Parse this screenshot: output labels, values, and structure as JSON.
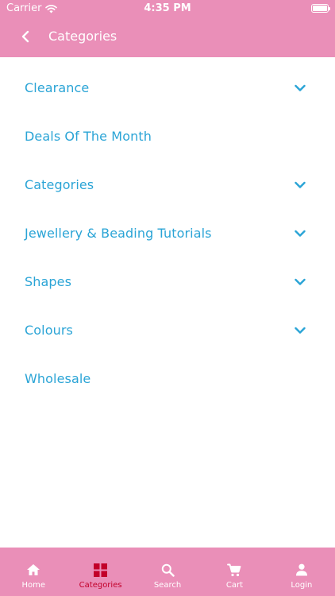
{
  "status_bar": {
    "carrier": "Carrier",
    "time": "4:35 PM",
    "wifi_icon": "wifi-icon",
    "battery_icon": "battery-icon"
  },
  "header": {
    "title": "Categories",
    "back_icon": "chevron-left-icon"
  },
  "menu": {
    "items": [
      {
        "label": "Clearance",
        "expandable": true
      },
      {
        "label": "Deals Of The Month",
        "expandable": false
      },
      {
        "label": "Categories",
        "expandable": true
      },
      {
        "label": "Jewellery & Beading Tutorials",
        "expandable": true
      },
      {
        "label": "Shapes",
        "expandable": true
      },
      {
        "label": "Colours",
        "expandable": true
      },
      {
        "label": "Wholesale",
        "expandable": false
      }
    ]
  },
  "tabbar": {
    "tabs": [
      {
        "label": "Home",
        "icon": "home-icon",
        "active": false
      },
      {
        "label": "Categories",
        "icon": "grid-icon",
        "active": true
      },
      {
        "label": "Search",
        "icon": "search-icon",
        "active": false
      },
      {
        "label": "Cart",
        "icon": "cart-icon",
        "active": false
      },
      {
        "label": "Login",
        "icon": "user-icon",
        "active": false
      }
    ]
  },
  "colors": {
    "header_bg": "#ea8fb8",
    "link_text": "#2aa4d6",
    "active_tab": "#c2002a"
  }
}
